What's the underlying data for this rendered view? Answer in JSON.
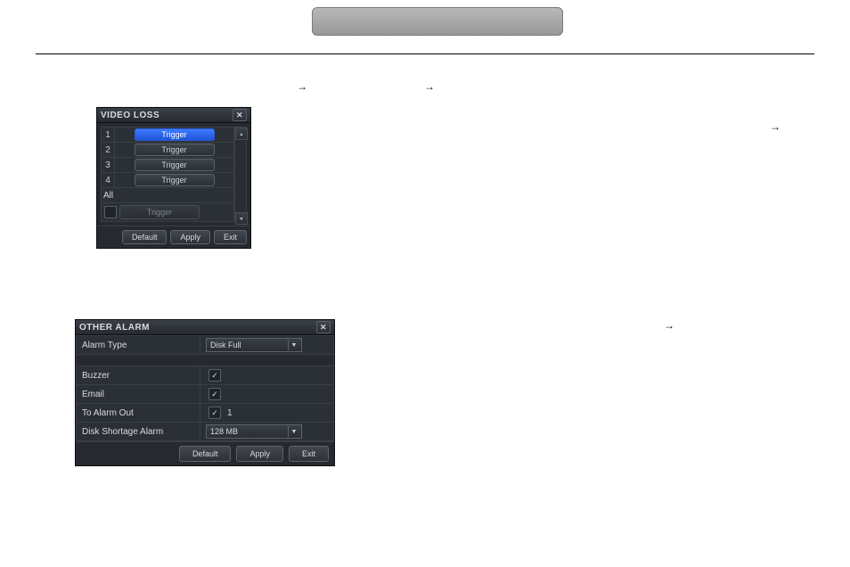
{
  "pill_label": "",
  "arrow_glyph": "→",
  "video_loss": {
    "title": "VIDEO LOSS",
    "close": "✕",
    "rows": [
      {
        "num": "1",
        "label": "Trigger",
        "highlighted": true
      },
      {
        "num": "2",
        "label": "Trigger",
        "highlighted": false
      },
      {
        "num": "3",
        "label": "Trigger",
        "highlighted": false
      },
      {
        "num": "4",
        "label": "Trigger",
        "highlighted": false
      }
    ],
    "all_label": "All",
    "all_trigger": "Trigger",
    "buttons": {
      "default": "Default",
      "apply": "Apply",
      "exit": "Exit"
    }
  },
  "other_alarm": {
    "title": "OTHER ALARM",
    "close": "✕",
    "rows": {
      "alarm_type": {
        "label": "Alarm Type",
        "value": "Disk Full"
      },
      "buzzer": {
        "label": "Buzzer",
        "checked": true
      },
      "email": {
        "label": "Email",
        "checked": true
      },
      "to_alarm_out": {
        "label": "To Alarm Out",
        "checked": true,
        "text": "1"
      },
      "disk_shortage": {
        "label": "Disk Shortage Alarm",
        "value": "128 MB"
      }
    },
    "buttons": {
      "default": "Default",
      "apply": "Apply",
      "exit": "Exit"
    }
  }
}
